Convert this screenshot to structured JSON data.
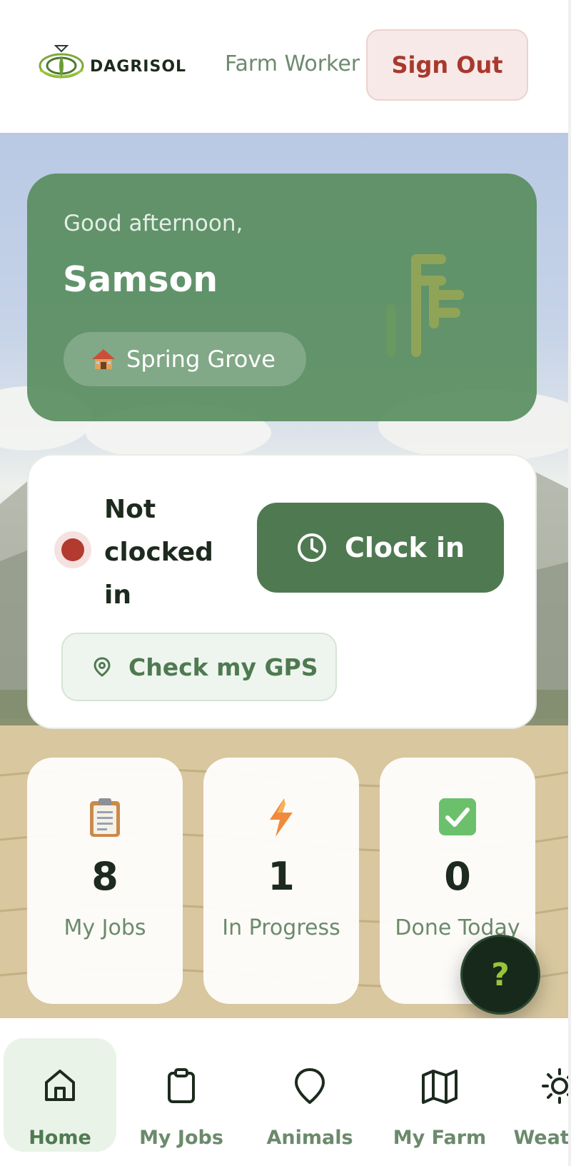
{
  "header": {
    "brand": "DAGRISOL",
    "role": "Farm Worker",
    "sign_out_label": "Sign Out"
  },
  "greeting": {
    "salutation": "Good afternoon,",
    "name": "Samson",
    "farm_icon": "house-emoji-icon",
    "farm_name": "Spring Grove"
  },
  "clock": {
    "status_label": "Not clocked in",
    "status_color": "#b23a2e",
    "clock_in_label": "Clock in",
    "check_gps_label": "Check my GPS"
  },
  "stats": [
    {
      "icon": "clipboard-emoji-icon",
      "value": "8",
      "label": "My Jobs"
    },
    {
      "icon": "lightning-emoji-icon",
      "value": "1",
      "label": "In Progress"
    },
    {
      "icon": "check-box-emoji-icon",
      "value": "0",
      "label": "Done Today"
    }
  ],
  "help_button": {
    "label": "?"
  },
  "nav": {
    "items": [
      {
        "label": "Home",
        "icon": "home-icon",
        "active": true
      },
      {
        "label": "My Jobs",
        "icon": "clipboard-icon",
        "active": false
      },
      {
        "label": "Animals",
        "icon": "map-pin-icon",
        "active": false
      },
      {
        "label": "My Farm",
        "icon": "map-icon",
        "active": false
      },
      {
        "label": "Weather",
        "icon": "sun-icon",
        "active": false
      }
    ]
  },
  "colors": {
    "primary_green": "#4f7a51",
    "greeting_card": "#568c5c",
    "sign_out_text": "#a8392e",
    "fab_background": "#16291a"
  }
}
